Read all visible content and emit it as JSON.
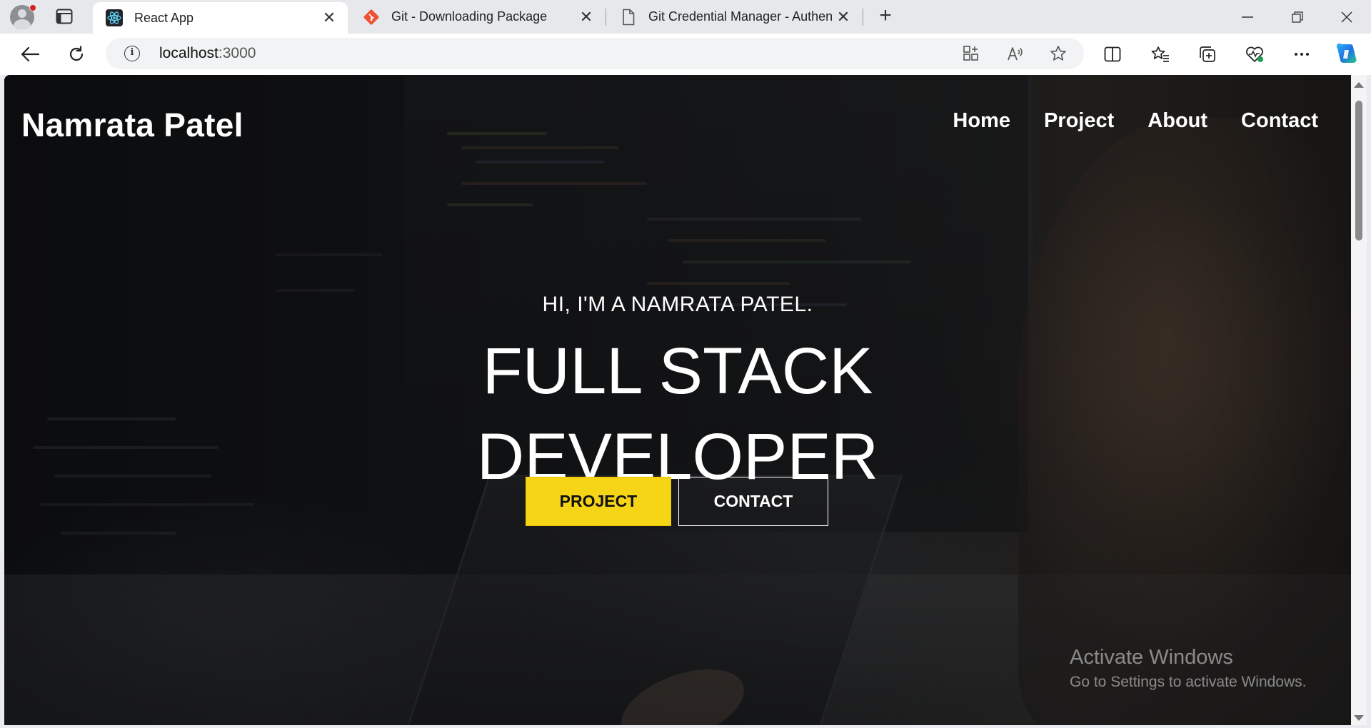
{
  "browser": {
    "tabs": [
      {
        "title": "React App",
        "icon": "react-icon",
        "active": true
      },
      {
        "title": "Git - Downloading Package",
        "icon": "git-icon",
        "active": false
      },
      {
        "title": "Git Credential Manager - Authen",
        "icon": "page-icon",
        "active": false
      }
    ],
    "address": {
      "host": "localhost",
      "port": ":3000"
    }
  },
  "page": {
    "brand": "Namrata Patel",
    "nav": [
      "Home",
      "Project",
      "About",
      "Contact"
    ],
    "hero": {
      "intro": "HI, I'M A NAMRATA PATEL.",
      "title_line1": "FULL STACK",
      "title_line2": "DEVELOPER",
      "primary_button": "PROJECT",
      "secondary_button": "CONTACT"
    },
    "colors": {
      "accent": "#f6d416",
      "text": "#ffffff"
    }
  },
  "watermark": {
    "title": "Activate Windows",
    "subtitle": "Go to Settings to activate Windows."
  }
}
